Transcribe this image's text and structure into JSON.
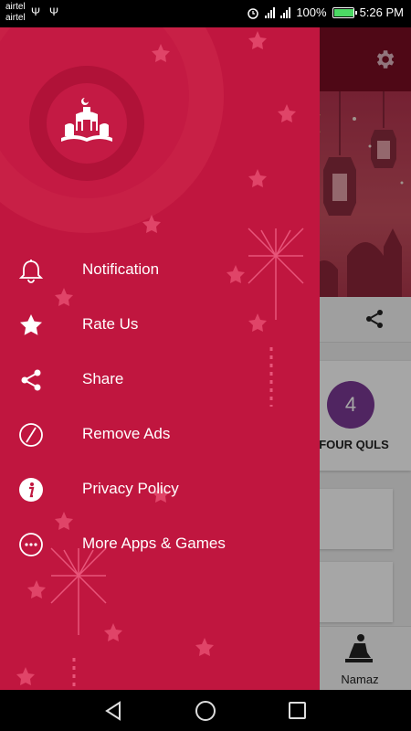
{
  "status_bar": {
    "carrier_1": "airtel",
    "carrier_2": "airtel",
    "usb_1": "Ψ",
    "usb_2": "Ψ",
    "battery_percent": "100%",
    "time": "5:26 PM",
    "battery_color": "#4cd964"
  },
  "drawer": {
    "background_color": "#c0163f",
    "menu": [
      {
        "label": "Notification",
        "icon": "bell-icon"
      },
      {
        "label": "Rate Us",
        "icon": "star-icon"
      },
      {
        "label": "Share",
        "icon": "share-icon"
      },
      {
        "label": "Remove Ads",
        "icon": "no-ads-icon"
      },
      {
        "label": "Privacy Policy",
        "icon": "info-icon"
      },
      {
        "label": "More Apps & Games",
        "icon": "more-icon"
      }
    ]
  },
  "background_app": {
    "toolbar_color": "#7a0d23",
    "card_label": "FOUR QULS",
    "card_badge": "4",
    "bottom_tab_label": "Namaz"
  }
}
